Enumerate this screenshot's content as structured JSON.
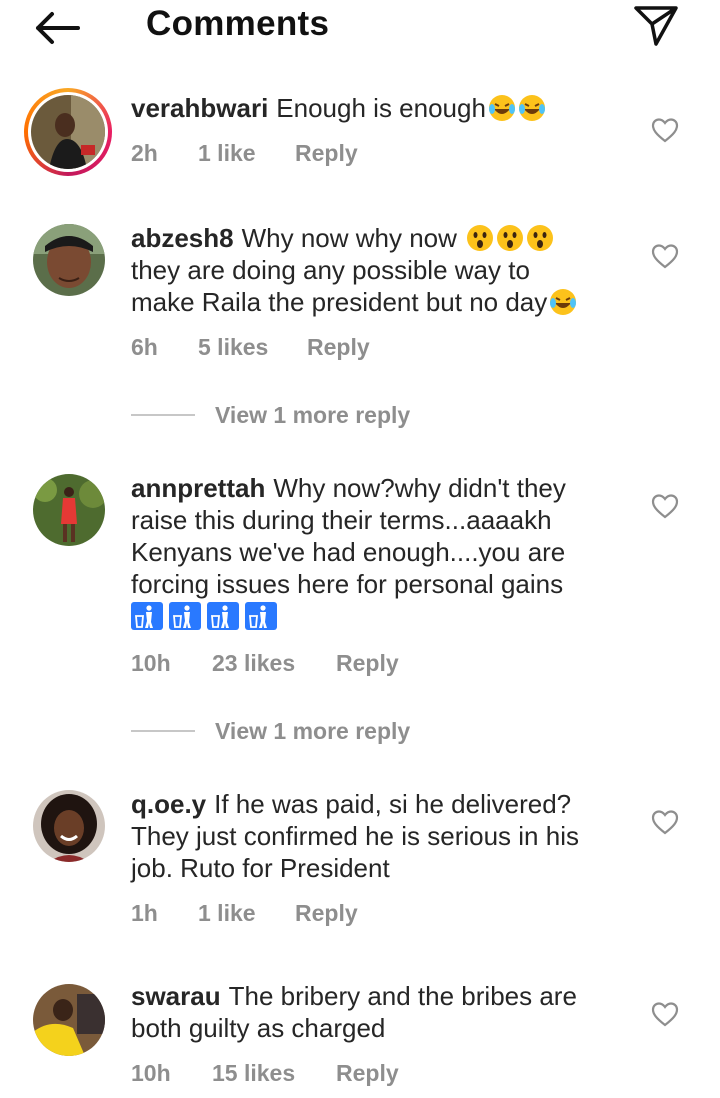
{
  "header": {
    "title": "Comments"
  },
  "comments": [
    {
      "username": "verahbwari",
      "text": "Enough is enough",
      "time": "2h",
      "likes": "1 like",
      "reply": "Reply"
    },
    {
      "username": "abzesh8",
      "text": "Why now why now",
      "line2": "they are doing any possible way to",
      "line3": "make Raila the president but no day",
      "time": "6h",
      "likes": "5 likes",
      "reply": "Reply",
      "view_more": "View 1 more reply"
    },
    {
      "username": "annprettah",
      "text": "Why now?why didn't they",
      "line2": "raise this during their terms...aaaakh",
      "line3": "Kenyans we've had enough....you are",
      "line4": "forcing issues here for personal gains",
      "time": "10h",
      "likes": "23 likes",
      "reply": "Reply",
      "view_more": "View 1 more reply"
    },
    {
      "username": "q.oe.y",
      "text": "If he was paid, si he delivered?",
      "line2": "They just confirmed he is serious in his",
      "line3": "job. Ruto for President",
      "time": "1h",
      "likes": "1 like",
      "reply": "Reply"
    },
    {
      "username": "swarau",
      "text": "The bribery and the bribes are",
      "line2": "both guilty as charged",
      "time": "10h",
      "likes": "15 likes",
      "reply": "Reply"
    }
  ],
  "icons": {
    "back": "arrow-left-icon",
    "send": "paper-plane-icon",
    "like": "heart-outline-icon"
  },
  "colors": {
    "meta_gray": "#8e8e8e",
    "text": "#262626"
  }
}
